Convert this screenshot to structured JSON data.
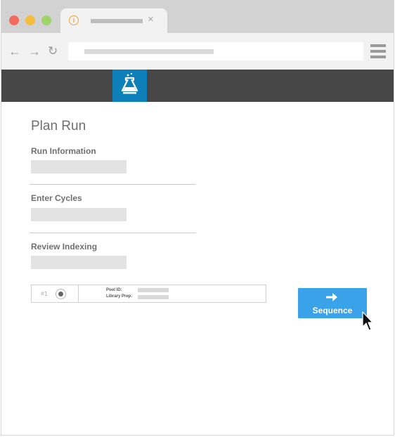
{
  "window": {
    "controls": [
      {
        "name": "close",
        "color": "#f26b5d"
      },
      {
        "name": "minimize",
        "color": "#f5bd3d"
      },
      {
        "name": "maximize",
        "color": "#9fd36b"
      }
    ]
  },
  "tab": {
    "icon_glyph": "i",
    "close_glyph": "×"
  },
  "toolbar": {
    "back_glyph": "←",
    "forward_glyph": "→",
    "reload_glyph": "↻"
  },
  "app": {
    "header_color": "#474747",
    "logo_tile_color": "#0d7fb9",
    "logo_icon": "flask-icon"
  },
  "page": {
    "title": "Plan Run",
    "sections": [
      {
        "label": "Run Information"
      },
      {
        "label": "Enter Cycles"
      },
      {
        "label": "Review Indexing"
      }
    ],
    "pool": {
      "number": "#1",
      "pool_id_label": "Pool ID:",
      "library_prep_label": "Library Prep:"
    },
    "sequence_button": {
      "label": "Sequence",
      "icon": "arrow-right-icon",
      "color": "#3aa2e8"
    }
  }
}
